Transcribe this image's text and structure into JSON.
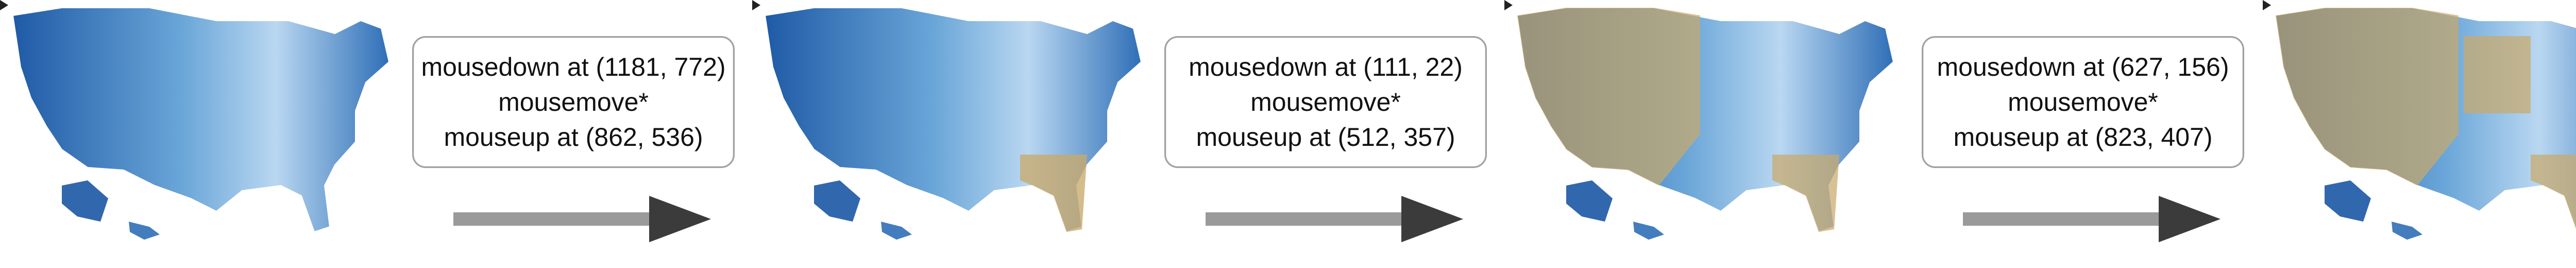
{
  "icons": {
    "cursor": "cursor-pointer-icon",
    "arrow": "right-arrow-icon"
  },
  "colors": {
    "map_light": "#cfe2f3",
    "map_mid": "#6aa6d8",
    "map_dark": "#1f5aa6",
    "selection": "#c9a96b",
    "arrow": "#9a9a9a",
    "arrowhead": "#3b3b3b",
    "box_border": "#a0a0a0"
  },
  "steps": [
    {
      "mousedown": "mousedown at (1181, 772)",
      "mousemove": "mousemove*",
      "mouseup": "mouseup at (862, 536)"
    },
    {
      "mousedown": "mousedown at (111, 22)",
      "mousemove": "mousemove*",
      "mouseup": "mouseup at (512, 357)"
    },
    {
      "mousedown": "mousedown at (627, 156)",
      "mousemove": "mousemove*",
      "mouseup": "mouseup at (823, 407)"
    }
  ]
}
